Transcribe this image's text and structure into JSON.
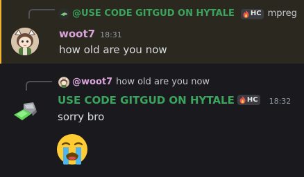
{
  "message1": {
    "reply": {
      "author": "@USE CODE GITGUD ON HYTALE",
      "tag": "HC",
      "text": "mpreg"
    },
    "author": "woot7",
    "timestamp": "18:31",
    "content": "how old are you now",
    "highlight_color": "#f0b232"
  },
  "message2": {
    "reply": {
      "author": "@woot7",
      "text": "how old are you now"
    },
    "author": "USE CODE GITGUD ON HYTALE",
    "tag": "HC",
    "timestamp": "18:32",
    "content": "sorry bro",
    "emoji": "loudly-crying-face"
  },
  "colors": {
    "background": "#1a1a1e",
    "highlight_background": "#2b2820",
    "green_name": "#3ba55d",
    "pink_name": "#d8a4d9"
  }
}
